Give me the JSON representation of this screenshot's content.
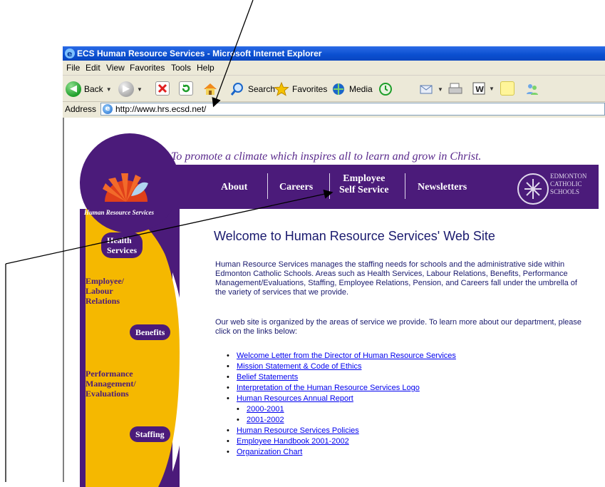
{
  "browser": {
    "title": "ECS Human Resource Services - Microsoft Internet Explorer",
    "menu": [
      "File",
      "Edit",
      "View",
      "Favorites",
      "Tools",
      "Help"
    ],
    "toolbar": {
      "back_label": "Back",
      "search_label": "Search",
      "favorites_label": "Favorites",
      "media_label": "Media"
    },
    "address": {
      "label": "Address",
      "url": "http://www.hrs.ecsd.net/"
    }
  },
  "site": {
    "tagline": "To promote a climate which inspires all to learn and grow in Christ.",
    "logo_text": "Human Resource Services",
    "nav": {
      "about": "About",
      "careers": "Careers",
      "employee_line1": "Employee",
      "employee_line2": "Self Service",
      "newsletters": "Newsletters"
    },
    "school": {
      "line1": "EDMONTON",
      "line2": "CATHOLIC",
      "line3": "SCHOOLS"
    },
    "sidebar": {
      "health_line1": "Health",
      "health_line2": "Services",
      "labour_line1": "Employee/",
      "labour_line2": "Labour",
      "labour_line3": "Relations",
      "benefits": "Benefits",
      "perf_line1": "Performance",
      "perf_line2": "Management/",
      "perf_line3": "Evaluations",
      "staffing": "Staffing"
    },
    "content": {
      "heading": "Welcome to Human Resource Services' Web Site",
      "para1": "Human Resource Services manages the staffing needs for schools and the administrative side within Edmonton Catholic Schools. Areas such as Health Services, Labour Relations, Benefits, Performance Management/Evaluations, Staffing, Employee Relations, Pension, and Careers fall under the umbrella of the variety of services that we provide.",
      "para2": "Our web site is organized by the areas of service we provide. To learn more about our department, please click on the links below:",
      "links": [
        "Welcome Letter from the Director of Human Resource Services",
        "Mission Statement & Code of Ethics",
        "Belief Statements",
        "Interpretation of the Human Resource Services Logo",
        "Human Resources Annual Report",
        "2000-2001",
        "2001-2002",
        "Human Resource Services Policies",
        "Employee Handbook 2001-2002",
        "Organization Chart"
      ]
    }
  },
  "colors": {
    "purple": "#4b1b7a",
    "gold": "#f5b800",
    "xp_blue": "#0a4fd0"
  }
}
